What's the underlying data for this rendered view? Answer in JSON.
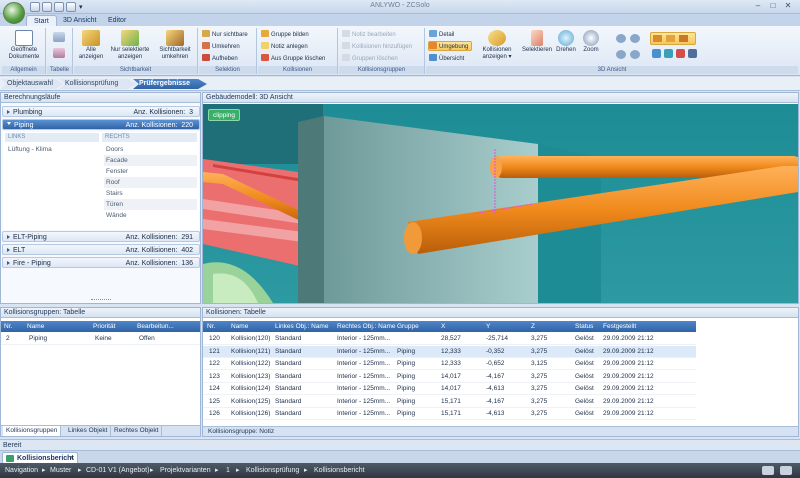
{
  "window": {
    "title": "ANLYWO - ZCSolo"
  },
  "ribbon": {
    "tabs": [
      "Start",
      "3D Ansicht",
      "Editor"
    ],
    "groups": {
      "allgemein": {
        "label": "Allgemein",
        "open_docs": "Geöffnete Dokumente"
      },
      "tabelle": {
        "label": "Tabelle"
      },
      "sichtbarkeit": {
        "label": "Sichtbarkeit",
        "all_show": "Alle anzeigen",
        "only_selected": "Nur selektierte anzeigen",
        "toggle_visibility": "Sichtbarkeit umkehren"
      },
      "selektion": {
        "label": "Selektion",
        "only_visible": "Nur sichtbare",
        "invert": "Umkehren",
        "cancel": "Aufheben"
      },
      "kollisionen": {
        "label": "Kollisionen",
        "create_group": "Gruppe bilden",
        "create_note": "Notiz anlegen",
        "remove_group": "Aus Gruppe löschen"
      },
      "kollisionsgruppen": {
        "label": "Kollisionsgruppen",
        "edit_note": "Notiz bearbeiten",
        "add_collisions": "Kollisionen hinzufügen",
        "delete_groups": "Gruppen löschen"
      },
      "ansicht3d": {
        "label": "3D Ansicht",
        "detail": "Detail",
        "environment": "Umgebung",
        "overview": "Übersicht",
        "show_collisions": "Kollisionen anzeigen",
        "select": "Selektieren",
        "rotate": "Drehen",
        "zoom": "Zoom"
      }
    }
  },
  "breadcrumb": [
    "Objektauswahl",
    "Kollisionsprüfung",
    "Prüfergebnisse"
  ],
  "left_pane": {
    "title": "Berechnungsläufe",
    "runs": [
      {
        "name": "Plumbing",
        "count_label": "Anz. Kollisionen:",
        "count": "3"
      },
      {
        "name": "Piping",
        "count_label": "Anz. Kollisionen:",
        "count": "220"
      },
      {
        "name": "ELT-Piping",
        "count_label": "Anz. Kollisionen:",
        "count": "291"
      },
      {
        "name": "ELT",
        "count_label": "Anz. Kollisionen:",
        "count": "402"
      },
      {
        "name": "Fire - Piping",
        "count_label": "Anz. Kollisionen:",
        "count": "136"
      }
    ],
    "links_header": "LINKS",
    "rechts_header": "RECHTS",
    "links_items": [
      "Lüftung - Klima"
    ],
    "rechts_items": [
      "Doors",
      "Facade",
      "Fenster",
      "Roof",
      "Stairs",
      "Türen",
      "Wände"
    ]
  },
  "viewport": {
    "title": "Gebäudemodell: 3D Ansicht",
    "badge": "clipping"
  },
  "group_table": {
    "title": "Kollisionsgruppen: Tabelle",
    "columns": [
      "Nr.",
      "Name",
      "Priorität",
      "Bearbeitun..."
    ],
    "rows": [
      [
        "2",
        "Piping",
        "Keine",
        "Offen"
      ]
    ],
    "tabs": [
      "Kollisionsgruppen",
      "Linkes Objekt",
      "Rechtes Objekt"
    ]
  },
  "collision_table": {
    "title": "Kollisionen: Tabelle",
    "columns": [
      "Nr.",
      "Name",
      "Linkes Obj.: Name",
      "Rechtes Obj.: Name",
      "Gruppe",
      "X",
      "Y",
      "Z",
      "Status",
      "Festgestellt"
    ],
    "rows": [
      [
        "120",
        "Kollision(120)",
        "Standard",
        "Interior - 125mm...",
        "",
        "28,527",
        "-25,714",
        "3,275",
        "Gelöst",
        "29.09.2009 21:12"
      ],
      [
        "121",
        "Kollision(121)",
        "Standard",
        "Interior - 125mm...",
        "Piping",
        "12,333",
        "-0,352",
        "3,275",
        "Gelöst",
        "29.09.2009 21:12"
      ],
      [
        "122",
        "Kollision(122)",
        "Standard",
        "Interior - 125mm...",
        "Piping",
        "12,333",
        "-0,652",
        "3,125",
        "Gelöst",
        "29.09.2009 21:12"
      ],
      [
        "123",
        "Kollision(123)",
        "Standard",
        "Interior - 125mm...",
        "Piping",
        "14,017",
        "-4,167",
        "3,275",
        "Gelöst",
        "29.09.2009 21:12"
      ],
      [
        "124",
        "Kollision(124)",
        "Standard",
        "Interior - 125mm...",
        "Piping",
        "14,017",
        "-4,613",
        "3,275",
        "Gelöst",
        "29.09.2009 21:12"
      ],
      [
        "125",
        "Kollision(125)",
        "Standard",
        "Interior - 125mm...",
        "Piping",
        "15,171",
        "-4,167",
        "3,275",
        "Gelöst",
        "29.09.2009 21:12"
      ],
      [
        "126",
        "Kollision(126)",
        "Standard",
        "Interior - 125mm...",
        "Piping",
        "15,171",
        "-4,613",
        "3,275",
        "Gelöst",
        "29.09.2009 21:12"
      ]
    ],
    "footer": "Kollisionsgruppe: Notiz"
  },
  "status": {
    "text": "Bereit"
  },
  "doc_tab": {
    "label": "Kollisionsbericht"
  },
  "navigation": {
    "label": "Navigation",
    "path": [
      "Muster",
      "CD-01 V1 (Angebot)",
      "Projektvarianten",
      "1",
      "Kollisionsprüfung",
      "Kollisionsbericht"
    ]
  }
}
